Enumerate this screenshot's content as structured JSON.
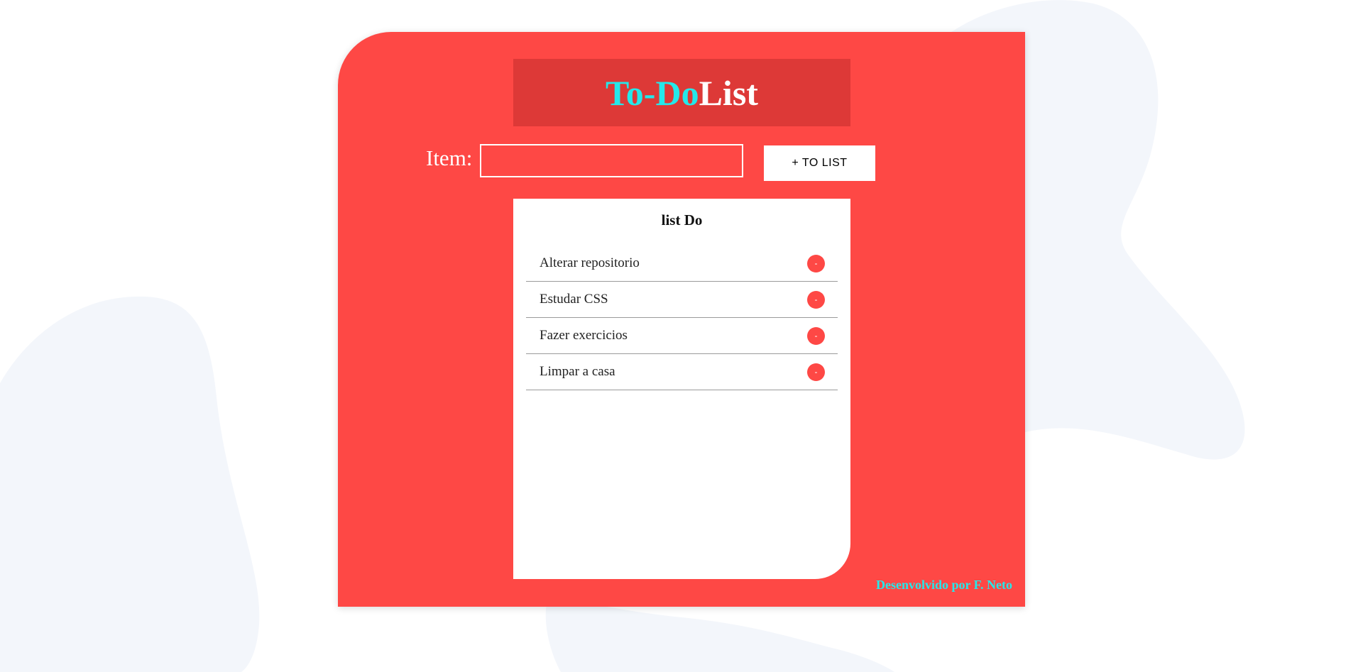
{
  "header": {
    "title_part1": "To-Do",
    "title_part2": "List"
  },
  "form": {
    "item_label": "Item:",
    "item_value": "",
    "add_button_label": "+ TO LIST"
  },
  "list": {
    "title": "list Do",
    "items": [
      {
        "text": "Alterar repositorio",
        "remove_label": "-"
      },
      {
        "text": "Estudar CSS",
        "remove_label": "-"
      },
      {
        "text": "Fazer exercicios",
        "remove_label": "-"
      },
      {
        "text": "Limpar a casa",
        "remove_label": "-"
      }
    ]
  },
  "footer": {
    "credit": "Desenvolvido por F. Neto"
  },
  "colors": {
    "card": "#fe4845",
    "title_bg": "#dd3937",
    "accent_cyan": "#24e8ea",
    "background_blob": "#f3f6fb"
  }
}
